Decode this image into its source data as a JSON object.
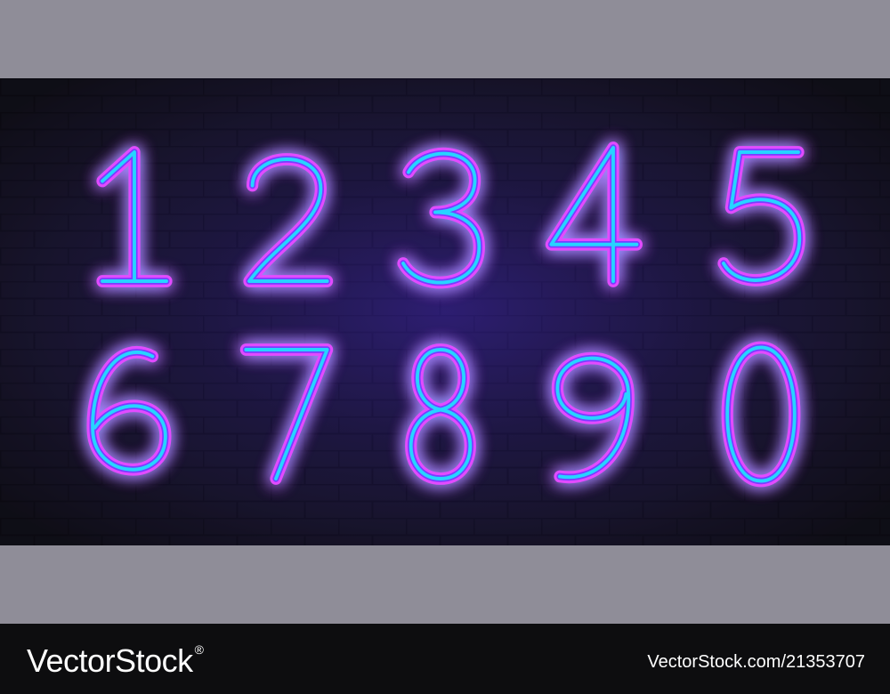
{
  "image": {
    "subject": "neon digits on brick wall",
    "digits_row1": [
      "1",
      "2",
      "3",
      "4",
      "5"
    ],
    "digits_row2": [
      "6",
      "7",
      "8",
      "9",
      "0"
    ],
    "colors": {
      "outer_tube": "#e24cff",
      "inner_tube": "#27d4ff",
      "glow": "#7a3cff",
      "wall": "#15131f",
      "bands": "#8f8d98",
      "footer": "#0d0d0f"
    }
  },
  "footer": {
    "brand": "VectorStock",
    "registered_mark": "®",
    "image_id": "VectorStock.com/21353707"
  }
}
